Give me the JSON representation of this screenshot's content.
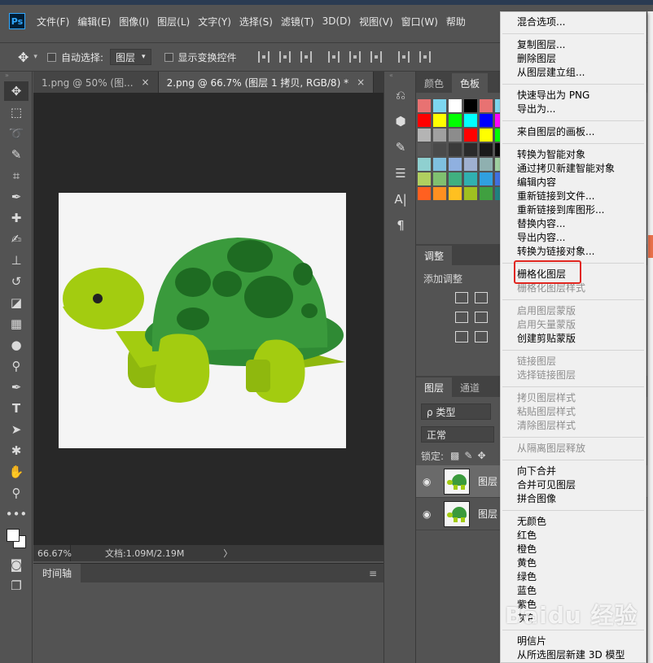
{
  "menubar": {
    "logo": "Ps",
    "items": [
      "文件(F)",
      "编辑(E)",
      "图像(I)",
      "图层(L)",
      "文字(Y)",
      "选择(S)",
      "滤镜(T)",
      "3D(D)",
      "视图(V)",
      "窗口(W)",
      "帮助"
    ]
  },
  "options": {
    "auto_select_label": "自动选择:",
    "auto_select_value": "图层",
    "show_transform_label": "显示变换控件"
  },
  "tabs": [
    {
      "label": "1.png @ 50% (图...",
      "close": "×"
    },
    {
      "label": "2.png @ 66.7% (图层 1 拷贝, RGB/8) *",
      "close": "×"
    }
  ],
  "status": {
    "zoom": "66.67%",
    "doc_info": "文档:1.09M/2.19M",
    "arrow": "〉"
  },
  "timeline": {
    "label": "时间轴",
    "menu": "≡"
  },
  "panels": {
    "color_tabs": [
      "颜色",
      "色板"
    ],
    "adjust_tab": "调整",
    "adjust_label": "添加调整",
    "layer_tabs": [
      "图层",
      "通道"
    ],
    "kind_label": "ρ 类型",
    "blend_mode": "正常",
    "lock_label": "锁定:",
    "layers": [
      {
        "name": "图层"
      },
      {
        "name": "图层"
      }
    ]
  },
  "swatch_colors": [
    [
      "#e87272",
      "#7dd6ef",
      "#ffffff",
      "#000000",
      "#e87272",
      "#7dd6ef"
    ],
    [
      "#ff0000",
      "#ffff00",
      "#00ff00",
      "#00ffff",
      "#0000ff",
      "#ff00ff"
    ],
    [
      "#b4b4b4",
      "#a0a0a0",
      "#8c8c8c",
      "#ff0000",
      "#ffff00",
      "#00ff00"
    ],
    [
      "#5a5a5a",
      "#4a4a4a",
      "#3a3a3a",
      "#2a2a2a",
      "#1a1a1a",
      "#0a0a0a"
    ],
    [
      "#8fd0d0",
      "#7fc0e0",
      "#8fb0e0",
      "#9fb0d0",
      "#8fb0b0",
      "#9fd0a0"
    ],
    [
      "#b0d060",
      "#80c070",
      "#40b080",
      "#30b0b0",
      "#30a0e0",
      "#4070e0"
    ],
    [
      "#ff6020",
      "#ff9020",
      "#ffc020",
      "#a0c020",
      "#40a040",
      "#208080"
    ]
  ],
  "context_menu": {
    "groups": [
      [
        {
          "label": "混合选项...",
          "disabled": false
        }
      ],
      [
        {
          "label": "复制图层...",
          "disabled": false
        },
        {
          "label": "删除图层",
          "disabled": false
        },
        {
          "label": "从图层建立组...",
          "disabled": false
        }
      ],
      [
        {
          "label": "快速导出为 PNG",
          "disabled": false
        },
        {
          "label": "导出为...",
          "disabled": false
        }
      ],
      [
        {
          "label": "来自图层的画板...",
          "disabled": false
        }
      ],
      [
        {
          "label": "转换为智能对象",
          "disabled": false
        },
        {
          "label": "通过拷贝新建智能对象",
          "disabled": false
        },
        {
          "label": "编辑内容",
          "disabled": false
        },
        {
          "label": "重新链接到文件...",
          "disabled": false
        },
        {
          "label": "重新链接到库图形...",
          "disabled": false
        },
        {
          "label": "替换内容...",
          "disabled": false
        },
        {
          "label": "导出内容...",
          "disabled": false
        },
        {
          "label": "转换为链接对象...",
          "disabled": false
        }
      ],
      [
        {
          "label": "栅格化图层",
          "disabled": false
        },
        {
          "label": "栅格化图层样式",
          "disabled": true
        }
      ],
      [
        {
          "label": "启用图层蒙版",
          "disabled": true
        },
        {
          "label": "启用矢量蒙版",
          "disabled": true
        },
        {
          "label": "创建剪贴蒙版",
          "disabled": false
        }
      ],
      [
        {
          "label": "链接图层",
          "disabled": true
        },
        {
          "label": "选择链接图层",
          "disabled": true
        }
      ],
      [
        {
          "label": "拷贝图层样式",
          "disabled": true
        },
        {
          "label": "粘贴图层样式",
          "disabled": true
        },
        {
          "label": "清除图层样式",
          "disabled": true
        }
      ],
      [
        {
          "label": "从隔离图层释放",
          "disabled": true
        }
      ],
      [
        {
          "label": "向下合并",
          "disabled": false
        },
        {
          "label": "合并可见图层",
          "disabled": false
        },
        {
          "label": "拼合图像",
          "disabled": false
        }
      ],
      [
        {
          "label": "无颜色",
          "disabled": false
        },
        {
          "label": "红色",
          "disabled": false
        },
        {
          "label": "橙色",
          "disabled": false
        },
        {
          "label": "黄色",
          "disabled": false
        },
        {
          "label": "绿色",
          "disabled": false
        },
        {
          "label": "蓝色",
          "disabled": false
        },
        {
          "label": "紫色",
          "disabled": false
        },
        {
          "label": "灰色",
          "disabled": false
        }
      ],
      [
        {
          "label": "明信片",
          "disabled": false
        },
        {
          "label": "从所选图层新建 3D 模型",
          "disabled": false
        }
      ]
    ]
  },
  "turtle": {
    "shell_color": "#3a9a3c",
    "shell_spot_color": "#1e6b22",
    "body_color": "#a3cc10"
  },
  "watermark": "Baidu 经验"
}
